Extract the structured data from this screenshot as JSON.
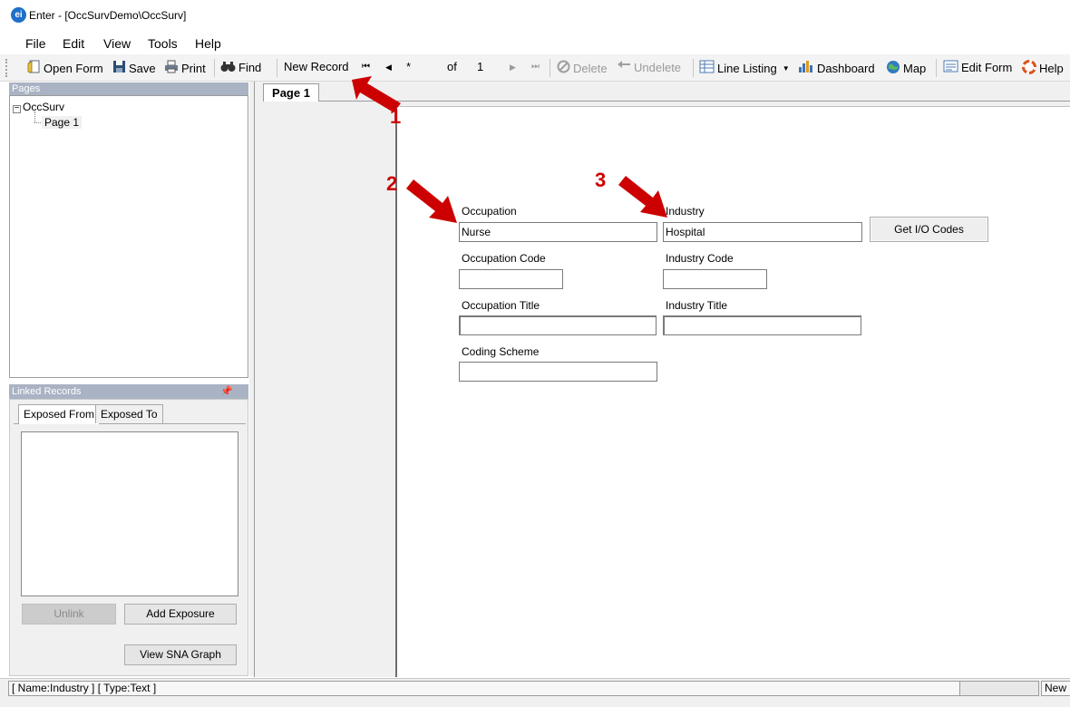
{
  "window": {
    "title": "Enter - [OccSurvDemo\\OccSurv]",
    "app_icon": "ei"
  },
  "menu": {
    "items": [
      "File",
      "Edit",
      "View",
      "Tools",
      "Help"
    ]
  },
  "toolbar": {
    "open_form": "Open Form",
    "save": "Save",
    "print": "Print",
    "find": "Find",
    "new_record": "New Record",
    "record_current": "*",
    "of_label": "of",
    "record_total": "1",
    "delete": "Delete",
    "undelete": "Undelete",
    "line_listing": "Line Listing",
    "dashboard": "Dashboard",
    "map": "Map",
    "edit_form": "Edit Form",
    "help": "Help"
  },
  "pages_panel": {
    "header": "Pages",
    "root": "OccSurv",
    "child": "Page 1"
  },
  "linked_records": {
    "header": "Linked Records",
    "tabs": [
      "Exposed From",
      "Exposed To"
    ],
    "unlink": "Unlink",
    "add_exposure": "Add Exposure",
    "view_sna": "View SNA Graph"
  },
  "form": {
    "page_tab": "Page 1",
    "occupation_label": "Occupation",
    "occupation_value": "Nurse",
    "industry_label": "Industry",
    "industry_value": "Hospital",
    "get_io_codes": "Get I/O Codes",
    "occupation_code_label": "Occupation Code",
    "occupation_code_value": "",
    "industry_code_label": "Industry Code",
    "industry_code_value": "",
    "occupation_title_label": "Occupation Title",
    "occupation_title_value": "",
    "industry_title_label": "Industry Title",
    "industry_title_value": "",
    "coding_scheme_label": "Coding Scheme",
    "coding_scheme_value": ""
  },
  "annotations": {
    "arrow1": "1",
    "arrow2": "2",
    "arrow3": "3",
    "color": "#cc0000"
  },
  "status": {
    "field_info": "[ Name:Industry ] [ Type:Text ]",
    "right": "New Record"
  }
}
